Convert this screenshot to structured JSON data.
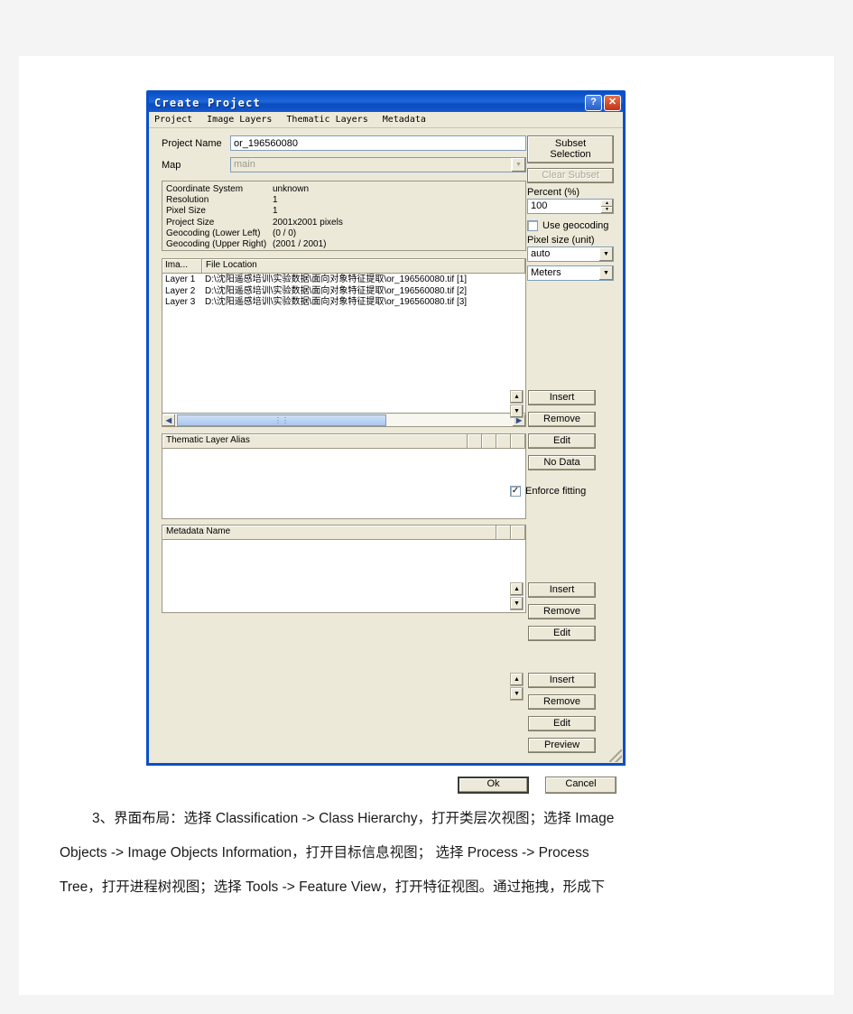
{
  "dialog": {
    "title": "Create Project",
    "titlebar_buttons": [
      {
        "name": "help-button",
        "glyph": "?"
      },
      {
        "name": "close-button",
        "glyph": "✕"
      }
    ],
    "menu": [
      "Project",
      "Image Layers",
      "Thematic Layers",
      "Metadata"
    ],
    "fields": {
      "project_name_label": "Project Name",
      "project_name_value": "or_196560080",
      "map_label": "Map",
      "map_value": "main"
    },
    "info": [
      {
        "key": "Coordinate System",
        "value": "unknown"
      },
      {
        "key": "Resolution",
        "value": "1"
      },
      {
        "key": "Pixel Size",
        "value": "1"
      },
      {
        "key": "Project Size",
        "value": "2001x2001 pixels"
      },
      {
        "key": "Geocoding (Lower Left)",
        "value": "(0 / 0)"
      },
      {
        "key": "Geocoding (Upper Right)",
        "value": "(2001 / 2001)"
      }
    ],
    "subset": {
      "subset_selection": "Subset\nSelection",
      "subset_selection_line1": "Subset",
      "subset_selection_line2": "Selection",
      "clear_subset": "Clear Subset",
      "percent_label": "Percent (%)",
      "percent_value": "100",
      "use_geocoding_label": "Use geocoding",
      "use_geocoding_checked": false,
      "pixel_size_label": "Pixel size (unit)",
      "pixel_size_value": "auto",
      "unit_value": "Meters"
    },
    "image_layers": {
      "columns": [
        "Ima...",
        "File Location"
      ],
      "rows": [
        {
          "layer": "Layer 1",
          "location": "D:\\沈阳遥感培训\\实验数据\\面向对象特征提取\\or_196560080.tif [1]"
        },
        {
          "layer": "Layer 2",
          "location": "D:\\沈阳遥感培训\\实验数据\\面向对象特征提取\\or_196560080.tif [2]"
        },
        {
          "layer": "Layer 3",
          "location": "D:\\沈阳遥感培训\\实验数据\\面向对象特征提取\\or_196560080.tif [3]"
        }
      ],
      "buttons": [
        "Insert",
        "Remove",
        "Edit",
        "No Data"
      ],
      "enforce_fitting_label": "Enforce fitting",
      "enforce_fitting_checked": true
    },
    "thematic_layers": {
      "column": "Thematic Layer Alias",
      "rows": [],
      "buttons": [
        "Insert",
        "Remove",
        "Edit"
      ]
    },
    "metadata": {
      "column": "Metadata Name",
      "rows": [],
      "buttons": [
        "Insert",
        "Remove",
        "Edit",
        "Preview"
      ]
    },
    "footer": {
      "ok": "Ok",
      "cancel": "Cancel"
    },
    "colors": {
      "titlebar": "#0a50c8",
      "face": "#ece9d8",
      "field_border": "#7f9db9"
    }
  },
  "page_text": {
    "lines": [
      "3、界面布局：选择 Classification -> Class Hierarchy，打开类层次视图；选择 Image",
      "Objects -> Image Objects Information，打开目标信息视图； 选择 Process -> Process",
      "Tree，打开进程树视图；选择 Tools -> Feature View，打开特征视图。通过拖拽，形成下"
    ]
  }
}
